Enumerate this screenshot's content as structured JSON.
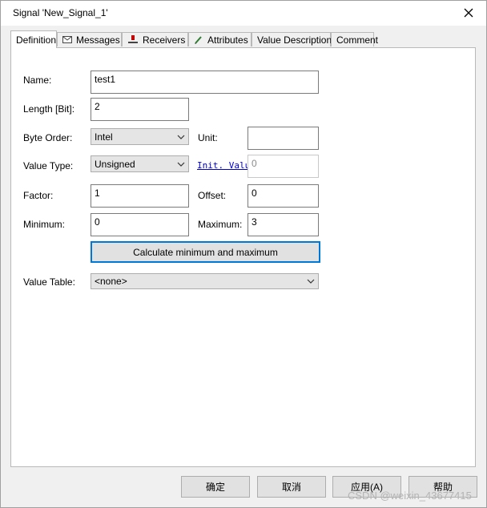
{
  "window": {
    "title": "Signal 'New_Signal_1'"
  },
  "tabs": [
    "Definition",
    "Messages",
    "Receivers",
    "Attributes",
    "Value Descriptions",
    "Comment"
  ],
  "form": {
    "name_label": "Name:",
    "name_value": "test1",
    "length_label": "Length [Bit]:",
    "length_value": "2",
    "byte_order_label": "Byte Order:",
    "byte_order_value": "Intel",
    "unit_label": "Unit:",
    "unit_value": "",
    "value_type_label": "Value Type:",
    "value_type_value": "Unsigned",
    "init_value_label": "Init. Value",
    "init_value_value": "0",
    "factor_label": "Factor:",
    "factor_value": "1",
    "offset_label": "Offset:",
    "offset_value": "0",
    "minimum_label": "Minimum:",
    "minimum_value": "0",
    "maximum_label": "Maximum:",
    "maximum_value": "3",
    "calc_button": "Calculate minimum and maximum",
    "value_table_label": "Value Table:",
    "value_table_value": "<none>"
  },
  "footer": {
    "ok": "确定",
    "cancel": "取消",
    "apply": "应用(A)",
    "help": "帮助"
  },
  "watermark": "CSDN @weixin_43677415",
  "colors": {
    "focus_border": "#0078d7",
    "link": "#0000cc",
    "panel_bg": "#ffffff",
    "dialog_bg": "#f0f0f0"
  }
}
